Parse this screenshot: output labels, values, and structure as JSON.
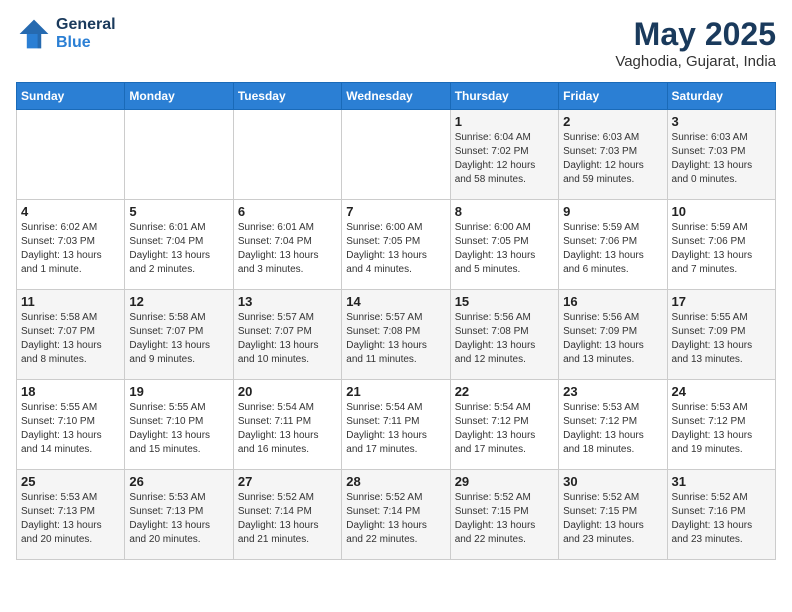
{
  "header": {
    "logo_line1": "General",
    "logo_line2": "Blue",
    "title": "May 2025",
    "subtitle": "Vaghodia, Gujarat, India"
  },
  "days_of_week": [
    "Sunday",
    "Monday",
    "Tuesday",
    "Wednesday",
    "Thursday",
    "Friday",
    "Saturday"
  ],
  "weeks": [
    [
      {
        "day": "",
        "sunrise": "",
        "sunset": "",
        "daylight": ""
      },
      {
        "day": "",
        "sunrise": "",
        "sunset": "",
        "daylight": ""
      },
      {
        "day": "",
        "sunrise": "",
        "sunset": "",
        "daylight": ""
      },
      {
        "day": "",
        "sunrise": "",
        "sunset": "",
        "daylight": ""
      },
      {
        "day": "1",
        "sunrise": "Sunrise: 6:04 AM",
        "sunset": "Sunset: 7:02 PM",
        "daylight": "Daylight: 12 hours and 58 minutes."
      },
      {
        "day": "2",
        "sunrise": "Sunrise: 6:03 AM",
        "sunset": "Sunset: 7:03 PM",
        "daylight": "Daylight: 12 hours and 59 minutes."
      },
      {
        "day": "3",
        "sunrise": "Sunrise: 6:03 AM",
        "sunset": "Sunset: 7:03 PM",
        "daylight": "Daylight: 13 hours and 0 minutes."
      }
    ],
    [
      {
        "day": "4",
        "sunrise": "Sunrise: 6:02 AM",
        "sunset": "Sunset: 7:03 PM",
        "daylight": "Daylight: 13 hours and 1 minute."
      },
      {
        "day": "5",
        "sunrise": "Sunrise: 6:01 AM",
        "sunset": "Sunset: 7:04 PM",
        "daylight": "Daylight: 13 hours and 2 minutes."
      },
      {
        "day": "6",
        "sunrise": "Sunrise: 6:01 AM",
        "sunset": "Sunset: 7:04 PM",
        "daylight": "Daylight: 13 hours and 3 minutes."
      },
      {
        "day": "7",
        "sunrise": "Sunrise: 6:00 AM",
        "sunset": "Sunset: 7:05 PM",
        "daylight": "Daylight: 13 hours and 4 minutes."
      },
      {
        "day": "8",
        "sunrise": "Sunrise: 6:00 AM",
        "sunset": "Sunset: 7:05 PM",
        "daylight": "Daylight: 13 hours and 5 minutes."
      },
      {
        "day": "9",
        "sunrise": "Sunrise: 5:59 AM",
        "sunset": "Sunset: 7:06 PM",
        "daylight": "Daylight: 13 hours and 6 minutes."
      },
      {
        "day": "10",
        "sunrise": "Sunrise: 5:59 AM",
        "sunset": "Sunset: 7:06 PM",
        "daylight": "Daylight: 13 hours and 7 minutes."
      }
    ],
    [
      {
        "day": "11",
        "sunrise": "Sunrise: 5:58 AM",
        "sunset": "Sunset: 7:07 PM",
        "daylight": "Daylight: 13 hours and 8 minutes."
      },
      {
        "day": "12",
        "sunrise": "Sunrise: 5:58 AM",
        "sunset": "Sunset: 7:07 PM",
        "daylight": "Daylight: 13 hours and 9 minutes."
      },
      {
        "day": "13",
        "sunrise": "Sunrise: 5:57 AM",
        "sunset": "Sunset: 7:07 PM",
        "daylight": "Daylight: 13 hours and 10 minutes."
      },
      {
        "day": "14",
        "sunrise": "Sunrise: 5:57 AM",
        "sunset": "Sunset: 7:08 PM",
        "daylight": "Daylight: 13 hours and 11 minutes."
      },
      {
        "day": "15",
        "sunrise": "Sunrise: 5:56 AM",
        "sunset": "Sunset: 7:08 PM",
        "daylight": "Daylight: 13 hours and 12 minutes."
      },
      {
        "day": "16",
        "sunrise": "Sunrise: 5:56 AM",
        "sunset": "Sunset: 7:09 PM",
        "daylight": "Daylight: 13 hours and 13 minutes."
      },
      {
        "day": "17",
        "sunrise": "Sunrise: 5:55 AM",
        "sunset": "Sunset: 7:09 PM",
        "daylight": "Daylight: 13 hours and 13 minutes."
      }
    ],
    [
      {
        "day": "18",
        "sunrise": "Sunrise: 5:55 AM",
        "sunset": "Sunset: 7:10 PM",
        "daylight": "Daylight: 13 hours and 14 minutes."
      },
      {
        "day": "19",
        "sunrise": "Sunrise: 5:55 AM",
        "sunset": "Sunset: 7:10 PM",
        "daylight": "Daylight: 13 hours and 15 minutes."
      },
      {
        "day": "20",
        "sunrise": "Sunrise: 5:54 AM",
        "sunset": "Sunset: 7:11 PM",
        "daylight": "Daylight: 13 hours and 16 minutes."
      },
      {
        "day": "21",
        "sunrise": "Sunrise: 5:54 AM",
        "sunset": "Sunset: 7:11 PM",
        "daylight": "Daylight: 13 hours and 17 minutes."
      },
      {
        "day": "22",
        "sunrise": "Sunrise: 5:54 AM",
        "sunset": "Sunset: 7:12 PM",
        "daylight": "Daylight: 13 hours and 17 minutes."
      },
      {
        "day": "23",
        "sunrise": "Sunrise: 5:53 AM",
        "sunset": "Sunset: 7:12 PM",
        "daylight": "Daylight: 13 hours and 18 minutes."
      },
      {
        "day": "24",
        "sunrise": "Sunrise: 5:53 AM",
        "sunset": "Sunset: 7:12 PM",
        "daylight": "Daylight: 13 hours and 19 minutes."
      }
    ],
    [
      {
        "day": "25",
        "sunrise": "Sunrise: 5:53 AM",
        "sunset": "Sunset: 7:13 PM",
        "daylight": "Daylight: 13 hours and 20 minutes."
      },
      {
        "day": "26",
        "sunrise": "Sunrise: 5:53 AM",
        "sunset": "Sunset: 7:13 PM",
        "daylight": "Daylight: 13 hours and 20 minutes."
      },
      {
        "day": "27",
        "sunrise": "Sunrise: 5:52 AM",
        "sunset": "Sunset: 7:14 PM",
        "daylight": "Daylight: 13 hours and 21 minutes."
      },
      {
        "day": "28",
        "sunrise": "Sunrise: 5:52 AM",
        "sunset": "Sunset: 7:14 PM",
        "daylight": "Daylight: 13 hours and 22 minutes."
      },
      {
        "day": "29",
        "sunrise": "Sunrise: 5:52 AM",
        "sunset": "Sunset: 7:15 PM",
        "daylight": "Daylight: 13 hours and 22 minutes."
      },
      {
        "day": "30",
        "sunrise": "Sunrise: 5:52 AM",
        "sunset": "Sunset: 7:15 PM",
        "daylight": "Daylight: 13 hours and 23 minutes."
      },
      {
        "day": "31",
        "sunrise": "Sunrise: 5:52 AM",
        "sunset": "Sunset: 7:16 PM",
        "daylight": "Daylight: 13 hours and 23 minutes."
      }
    ]
  ]
}
